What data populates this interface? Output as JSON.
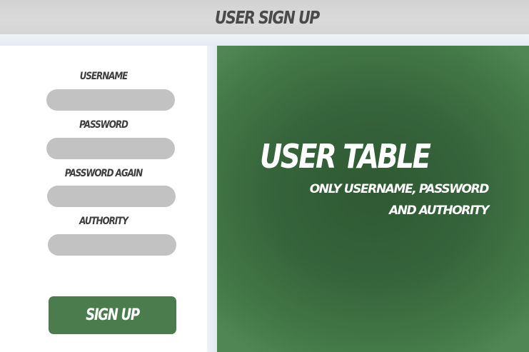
{
  "header": {
    "title": "USER SIGN UP"
  },
  "form": {
    "fields": [
      {
        "label": "USERNAME",
        "value": "",
        "placeholder": ""
      },
      {
        "label": "PASSWORD",
        "value": "",
        "placeholder": ""
      },
      {
        "label": "PASSWORD AGAIN",
        "value": "",
        "placeholder": ""
      },
      {
        "label": "AUTHORITY",
        "value": "",
        "placeholder": ""
      }
    ],
    "submit_label": "SIGN UP"
  },
  "info": {
    "title": "USER TABLE",
    "subtitle": "ONLY USERNAME, PASSWORD AND AUTHORITY"
  },
  "colors": {
    "header_bg": "#d6d6d6",
    "input_bg": "#c2c2c2",
    "button_bg": "#4a7c4d",
    "panel_green": "#35633a",
    "page_bg": "#e4ebf4"
  }
}
